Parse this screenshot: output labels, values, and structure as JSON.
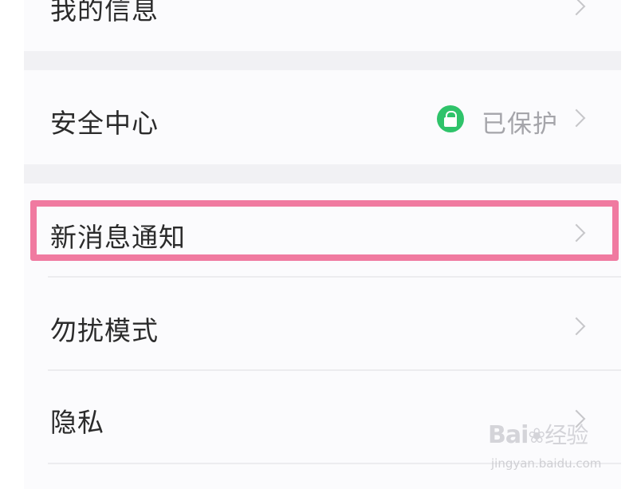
{
  "settings": {
    "rows": [
      {
        "label": "我的信息"
      },
      {
        "label": "安全中心",
        "status": "已保护"
      },
      {
        "label": "新消息通知"
      },
      {
        "label": "勿扰模式"
      },
      {
        "label": "隐私"
      }
    ]
  },
  "highlight": {
    "color": "#f07aa0"
  },
  "icons": {
    "chevron": "chevron-right-icon",
    "lock": "lock-icon",
    "status_color": "#2fc36a"
  },
  "watermark": {
    "brand": "Bai",
    "brand_suffix": "经验",
    "url": "jingyan.baidu.com"
  }
}
